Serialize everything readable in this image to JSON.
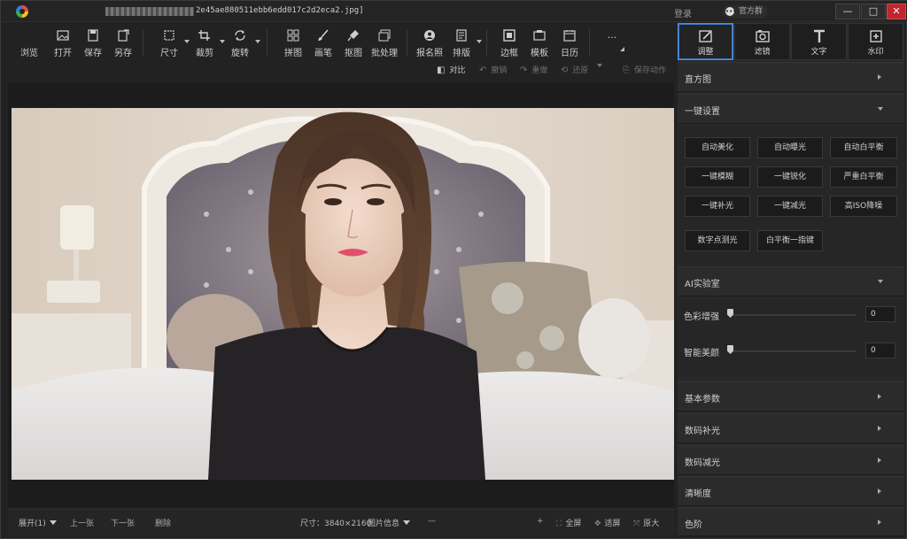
{
  "window": {
    "file_name": "2e45ae880511ebb6edd017c2d2eca2.jpg]",
    "login": "登录",
    "vip": "官方群",
    "minimize": "—",
    "maximize": "□",
    "close": "✕"
  },
  "toolbar": {
    "items": [
      {
        "label": "浏览"
      },
      {
        "label": "打开"
      },
      {
        "label": "保存"
      },
      {
        "label": "另存"
      },
      {
        "label": "尺寸"
      },
      {
        "label": "裁剪"
      },
      {
        "label": "旋转"
      },
      {
        "label": "拼图"
      },
      {
        "label": "画笔"
      },
      {
        "label": "抠图"
      },
      {
        "label": "批处理"
      },
      {
        "label": "报名照"
      },
      {
        "label": "排版"
      },
      {
        "label": "边框"
      },
      {
        "label": "模板"
      },
      {
        "label": "日历"
      },
      {
        "label": "..."
      }
    ]
  },
  "subbar": {
    "compare": "对比",
    "undo": "撤销",
    "redo": "重做",
    "restore": "还原",
    "save_action": "保存动作"
  },
  "bottom": {
    "expand": "展开(1)",
    "prev": "上一张",
    "next": "下一张",
    "delete": "删除",
    "size": "尺寸：3840×2160",
    "info": "图片信息",
    "minus": "—",
    "plus": "+",
    "fullscreen": "全屏",
    "fit": "适屏",
    "original": "原大"
  },
  "panel": {
    "tabs": [
      {
        "label": "调整"
      },
      {
        "label": "滤镜"
      },
      {
        "label": "文字"
      },
      {
        "label": "水印"
      }
    ],
    "histogram": "直方图",
    "oneclick": "一键设置",
    "presets": [
      "自动美化",
      "自动曝光",
      "自动白平衡",
      "一键模糊",
      "一键锐化",
      "严重白平衡",
      "一键补光",
      "一键减光",
      "高ISO降噪",
      "数字点测光",
      "白平衡一指键"
    ],
    "ai_lab": "AI实验室",
    "sliders": [
      {
        "label": "色彩增强",
        "value": "0"
      },
      {
        "label": "智能美颜",
        "value": "0"
      }
    ],
    "sections": [
      "基本参数",
      "数码补光",
      "数码减光",
      "清晰度",
      "色阶"
    ]
  }
}
